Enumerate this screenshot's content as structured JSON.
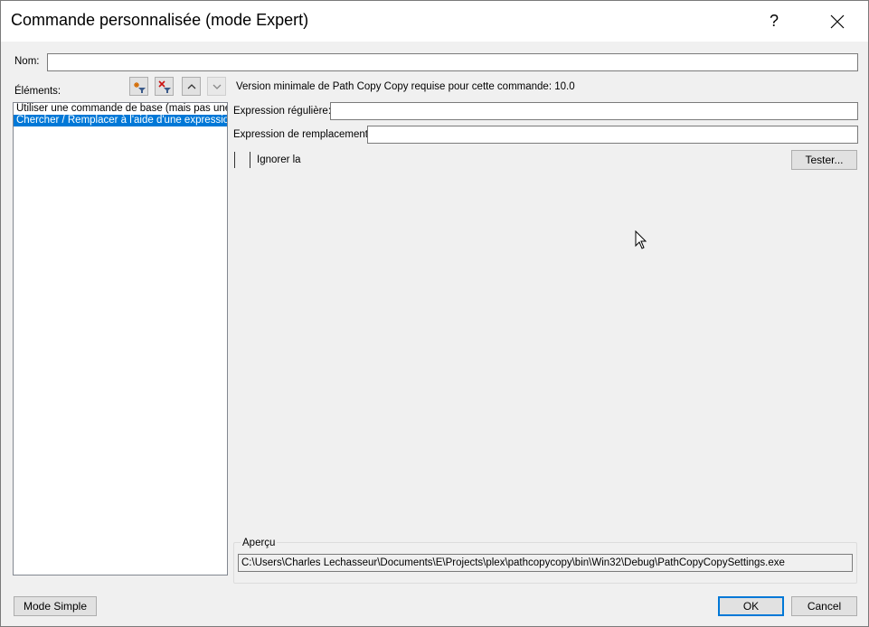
{
  "window": {
    "title": "Commande personnalisée (mode Expert)",
    "help_label": "?"
  },
  "name_field": {
    "label": "Nom:",
    "value": ""
  },
  "elements": {
    "label": "Éléments:",
    "items": [
      {
        "label": "Utiliser une commande de base (mais pas une cor",
        "selected": false
      },
      {
        "label": "Chercher / Remplacer à l'aide d'une expression re",
        "selected": true
      }
    ],
    "toolbar": [
      "add-element-icon",
      "remove-element-icon",
      "move-up-icon",
      "move-down-icon"
    ]
  },
  "details": {
    "min_version_text": "Version minimale de Path Copy Copy requise pour cette commande: 10.0",
    "regex_label": "Expression régulière:",
    "regex_value": "",
    "replacement_label": "Expression de remplacement:",
    "replacement_value": "",
    "ignore_case_label": "Ignorer la",
    "ignore_case_checked": false,
    "test_button": "Tester..."
  },
  "preview": {
    "label": "Aperçu",
    "value": "C:\\Users\\Charles Lechasseur\\Documents\\E\\Projects\\plex\\pathcopycopy\\bin\\Win32\\Debug\\PathCopyCopySettings.exe"
  },
  "footer": {
    "simple_mode_button": "Mode Simple",
    "ok_button": "OK",
    "cancel_button": "Cancel"
  },
  "colors": {
    "accent": "#0078d7",
    "window_bg": "#f0f0f0",
    "titlebar_bg": "#ffffff"
  }
}
